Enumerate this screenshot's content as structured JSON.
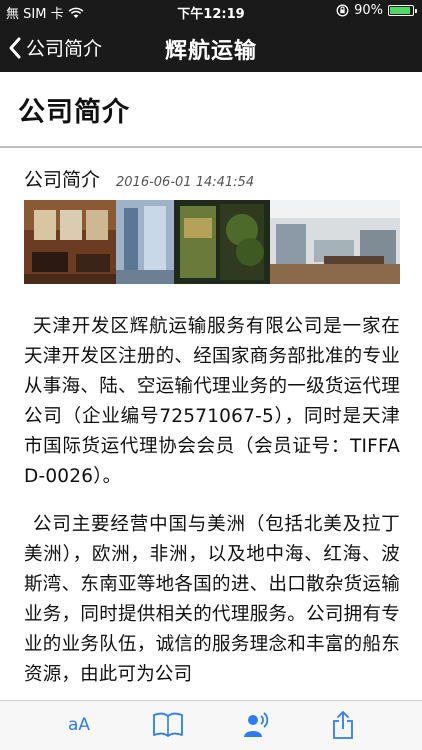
{
  "status": {
    "carrier": "無 SIM 卡",
    "time": "下午12:19",
    "battery_percent": "90%",
    "battery_level": 0.9
  },
  "nav": {
    "back_label": "公司简介",
    "title": "辉航运输"
  },
  "page": {
    "title": "公司简介"
  },
  "article": {
    "title": "公司简介",
    "date": "2016-06-01 14:41:54",
    "paragraphs": [
      "天津开发区辉航运输服务有限公司是一家在天津开发区注册的、经国家商务部批准的专业从事海、陆、空运输代理业务的一级货运代理公司（企业编号72571067-5），同时是天津市国际货运代理协会会员（会员证号：TIFFA D-0026）。",
      "公司主要经营中国与美洲（包括北美及拉丁美洲），欧洲，非洲，以及地中海、红海、波斯湾、东南亚等地各国的进、出口散杂货运输业务，同时提供相关的代理服务。公司拥有专业的业务队伍，诚信的服务理念和丰富的船东资源，由此可为公司"
    ]
  },
  "tabbar": {
    "font_label": "aA",
    "accent": "#2f7bf6"
  },
  "colors": {
    "topbar": "#1a1a1a",
    "accent": "#2f7bf6",
    "battery": "#4cd964"
  }
}
